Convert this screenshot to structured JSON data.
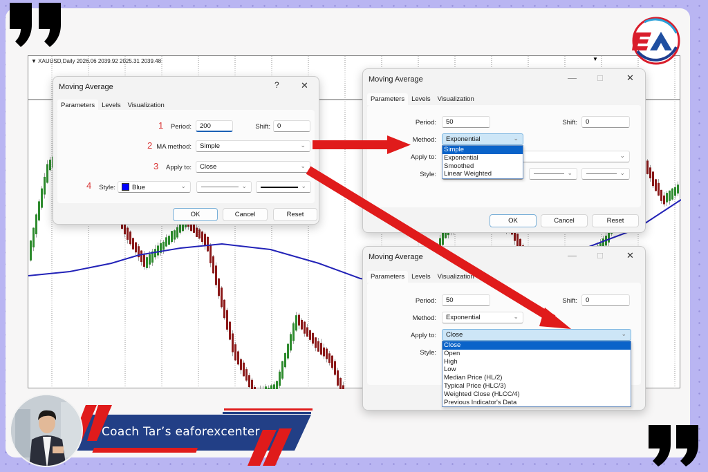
{
  "chart": {
    "header": "XAUUSD,Daily  2026.06 2039.92 2025.31 2039.48",
    "symbol": "XAUUSD",
    "timeframe": "Daily",
    "ohlc": {
      "open": "2026.06",
      "high": "2039.92",
      "low": "2025.31",
      "close": "2039.48"
    },
    "ma_color": "#2323b8",
    "bull_color": "#2e8b2e",
    "bear_color": "#8b1a1a"
  },
  "dialog_main": {
    "title": "Moving Average",
    "help_label": "?",
    "close_label": "✕",
    "tabs": [
      "Parameters",
      "Levels",
      "Visualization"
    ],
    "active_tab": "Parameters",
    "steps": [
      "1",
      "2",
      "3",
      "4"
    ],
    "period_label": "Period:",
    "period_value": "200",
    "shift_label": "Shift:",
    "shift_value": "0",
    "method_label": "MA method:",
    "method_value": "Simple",
    "apply_label": "Apply to:",
    "apply_value": "Close",
    "style_label": "Style:",
    "style_color": "Blue",
    "style_color_hex": "#0000ff",
    "ok_label": "OK",
    "cancel_label": "Cancel",
    "reset_label": "Reset"
  },
  "dialog_method": {
    "title": "Moving Average",
    "minimize_label": "—",
    "maximize_label": "☐",
    "close_label": "✕",
    "tabs": [
      "Parameters",
      "Levels",
      "Visualization"
    ],
    "period_label": "Period:",
    "period_value": "50",
    "shift_label": "Shift:",
    "shift_value": "0",
    "method_label": "Method:",
    "method_value": "Exponential",
    "method_options": [
      "Simple",
      "Exponential",
      "Smoothed",
      "Linear Weighted"
    ],
    "method_highlighted": "Simple",
    "apply_label": "Apply to:",
    "style_label": "Style:",
    "ok_label": "OK",
    "cancel_label": "Cancel",
    "reset_label": "Reset"
  },
  "dialog_apply": {
    "title": "Moving Average",
    "minimize_label": "—",
    "maximize_label": "☐",
    "close_label": "✕",
    "tabs": [
      "Parameters",
      "Levels",
      "Visualization"
    ],
    "period_label": "Period:",
    "period_value": "50",
    "shift_label": "Shift:",
    "shift_value": "0",
    "method_label": "Method:",
    "method_value": "Exponential",
    "apply_label": "Apply to:",
    "apply_value": "Close",
    "apply_options": [
      "Close",
      "Open",
      "High",
      "Low",
      "Median Price (HL/2)",
      "Typical Price (HLC/3)",
      "Weighted Close (HLCC/4)",
      "Previous Indicator's Data"
    ],
    "apply_highlighted": "Close",
    "style_label": "Style:"
  },
  "branding": {
    "logo_text": "EA",
    "banner_text": "Coach Tar’s eaforexcenter",
    "quote_open": "“",
    "quote_close": "”",
    "accent_red": "#e01b1b",
    "accent_blue": "#223f86"
  }
}
